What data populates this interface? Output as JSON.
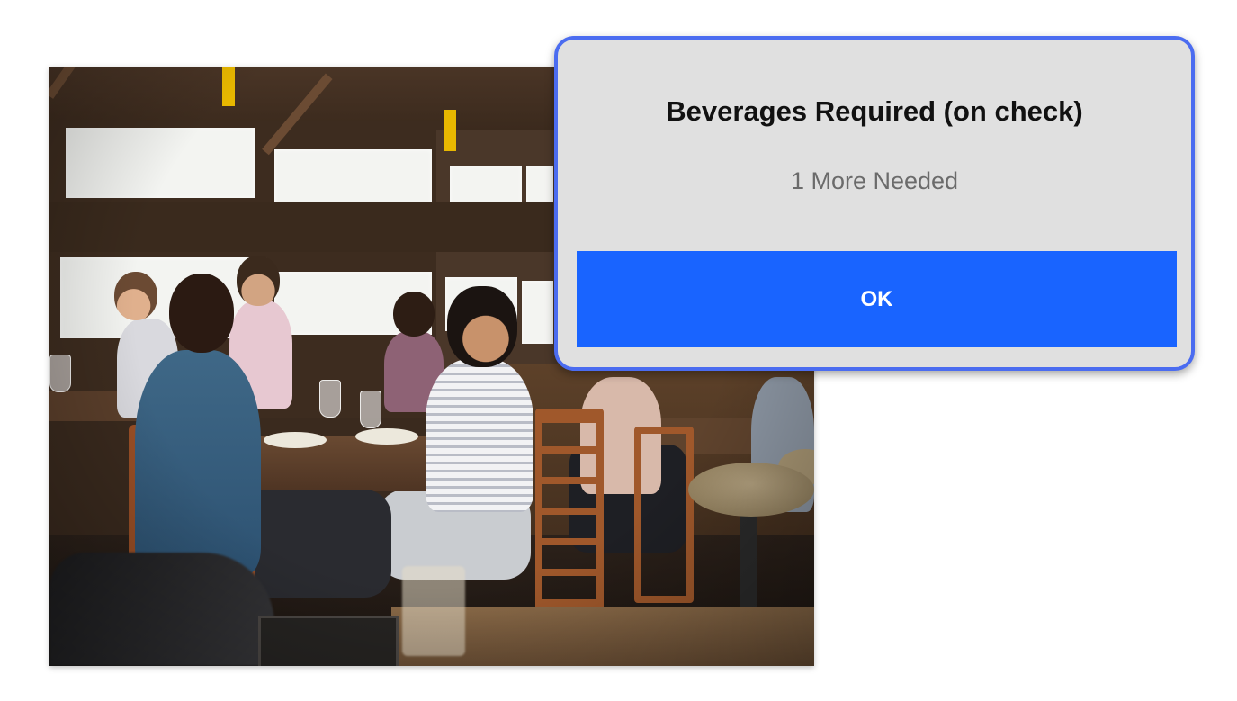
{
  "dialog": {
    "title": "Beverages Required (on check)",
    "subtitle": "1 More Needed",
    "ok_label": "OK",
    "accent_color": "#1964ff",
    "border_color": "#4b6cf0",
    "background_color": "#e0e0e0"
  },
  "background_image": {
    "icon": "restaurant-photo"
  }
}
